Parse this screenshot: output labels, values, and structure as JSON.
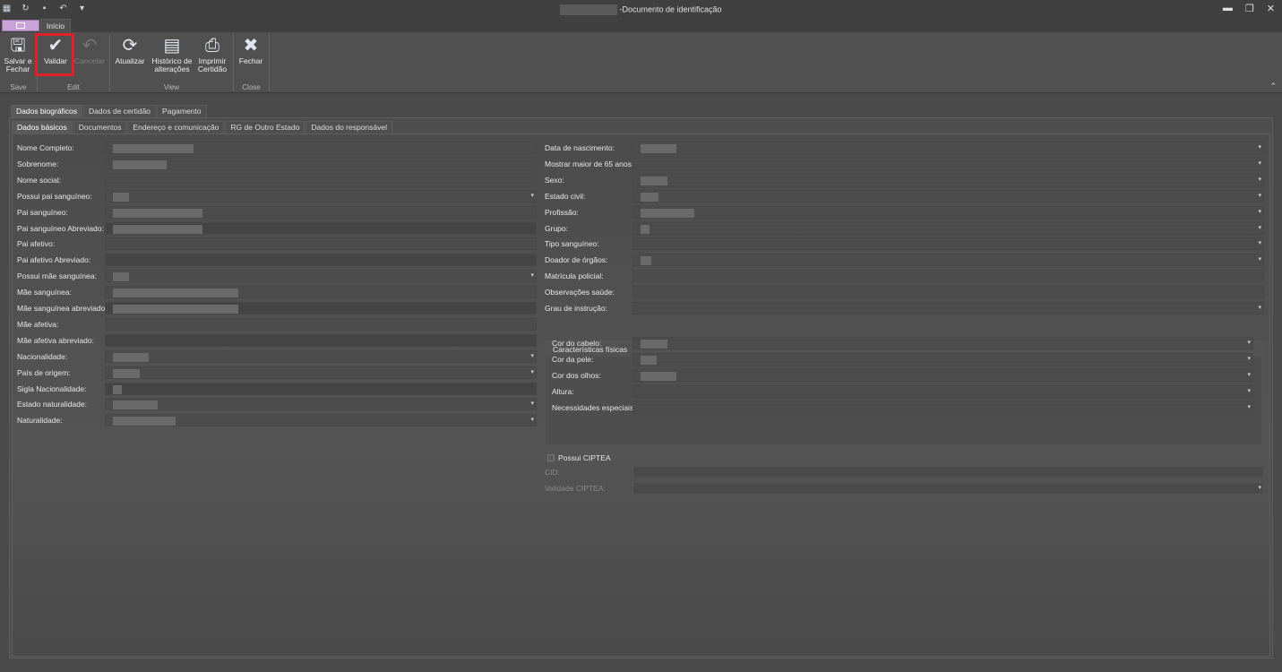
{
  "window": {
    "title": "Documento de identificação"
  },
  "tabs": {
    "home": "Início"
  },
  "ribbon": {
    "save_close": "Salvar e Fechar",
    "validate": "Validar",
    "cancel": "Cancelar",
    "refresh": "Atualizar",
    "history": "Histórico de alterações",
    "print": "Imprimir Certidão",
    "close": "Fechar",
    "groups": {
      "save": "Save",
      "edit": "Edit",
      "view": "View",
      "close": "Close"
    }
  },
  "outer_tabs": [
    "Dados biográficos",
    "Dados de certidão",
    "Pagamento"
  ],
  "inner_tabs": [
    "Dados básicos",
    "Documentos",
    "Endereço e comunicação",
    "RG de Outro Estado",
    "Dados do responsável"
  ],
  "left_fields": [
    {
      "label": "Nome Completo:"
    },
    {
      "label": "Sobrenome:"
    },
    {
      "label": "Nome social:"
    },
    {
      "label": "Possui pai sanguíneo:"
    },
    {
      "label": "Pai sanguíneo:"
    },
    {
      "label": "Pai sanguíneo Abreviado:"
    },
    {
      "label": "Pai afetivo:"
    },
    {
      "label": "Pai afetivo Abreviado:"
    },
    {
      "label": "Possui mãe sanguínea:"
    },
    {
      "label": "Mãe sanguínea:"
    },
    {
      "label": "Mãe sanguínea abreviado:"
    },
    {
      "label": "Mãe afetiva:"
    },
    {
      "label": "Mãe afetiva abreviado:"
    },
    {
      "label": "Nacionalidade:"
    },
    {
      "label": "País de origem:"
    },
    {
      "label": "Sigla Nacionalidade:"
    },
    {
      "label": "Estado naturalidade:"
    },
    {
      "label": "Naturalidade:"
    }
  ],
  "right_fields": [
    {
      "label": "Data de nascimento:"
    },
    {
      "label": "Mostrar maior de 65 anos:"
    },
    {
      "label": "Sexo:"
    },
    {
      "label": "Estado civil:"
    },
    {
      "label": "Profissão:"
    },
    {
      "label": "Grupo:"
    },
    {
      "label": "Tipo sanguíneo:"
    },
    {
      "label": "Doador de órgãos:"
    },
    {
      "label": "Matrícula policial:"
    },
    {
      "label": "Observações saúde:"
    },
    {
      "label": "Grau de instrução:"
    }
  ],
  "physical": {
    "title": "Características físicas",
    "fields": [
      {
        "label": "Cor do cabelo:"
      },
      {
        "label": "Cor da pele:"
      },
      {
        "label": "Cor dos olhos:"
      },
      {
        "label": "Altura:"
      },
      {
        "label": "Necessidades especiais:"
      }
    ]
  },
  "ciptea": {
    "checkbox": "Possui CIPTEA",
    "cid": "CID:",
    "validity": "Validade CIPTEA:"
  }
}
